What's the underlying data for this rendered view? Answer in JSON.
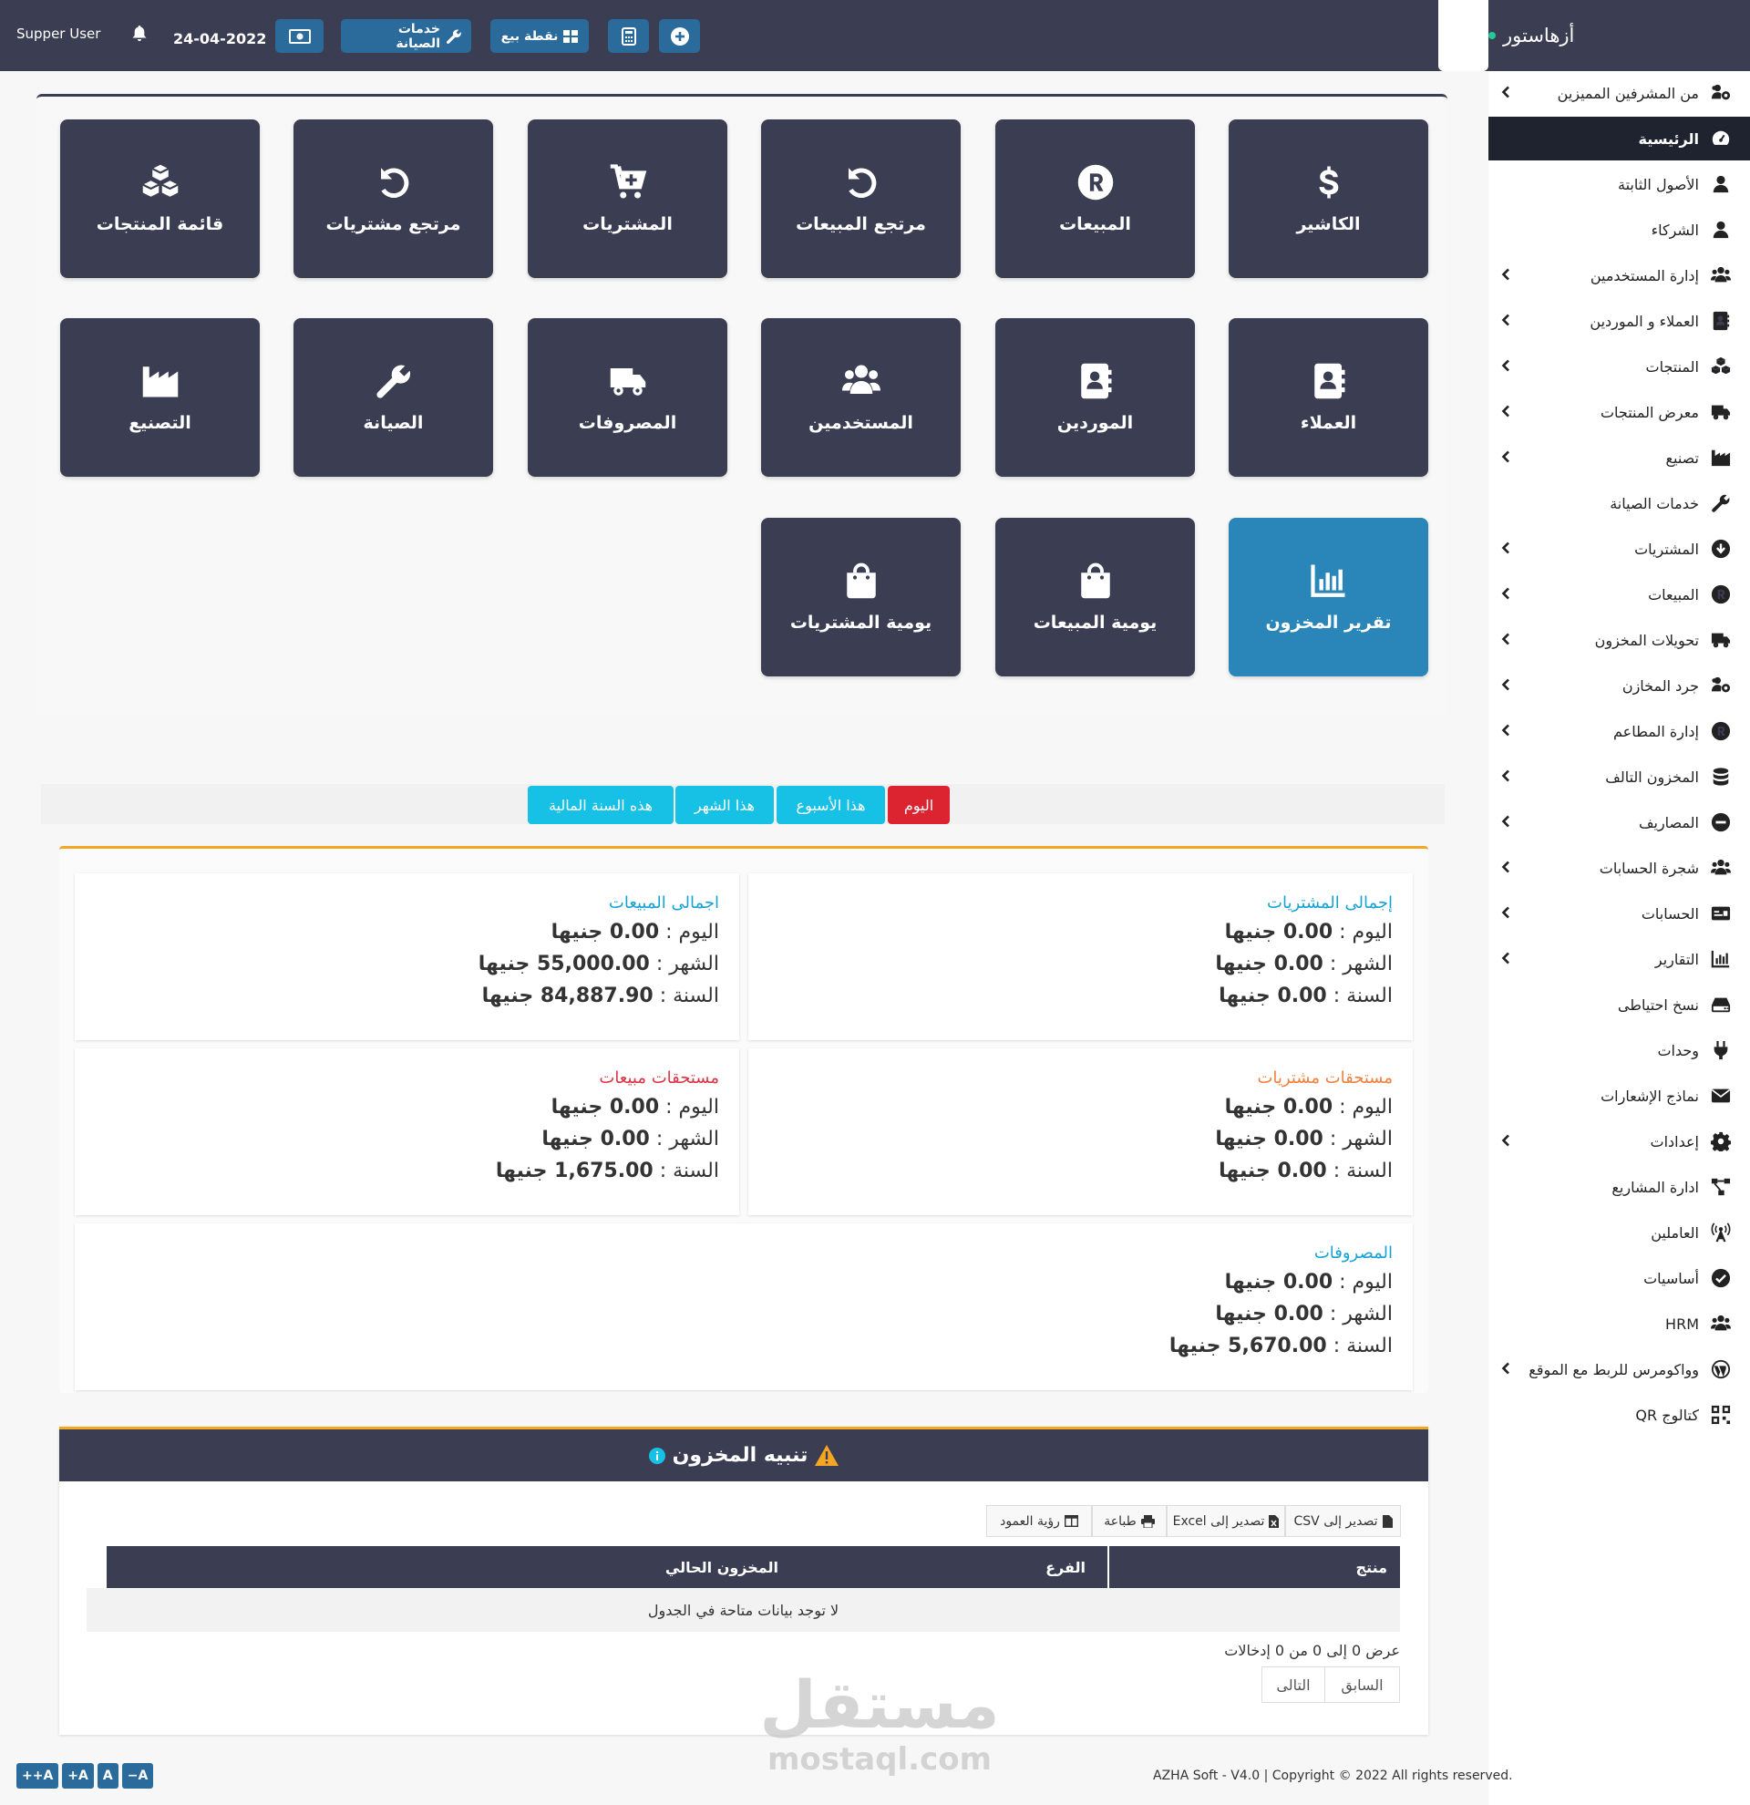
{
  "brand": {
    "name": "أزهاستور"
  },
  "topbar": {
    "user": "Supper User",
    "date": "24-04-2022",
    "maintenance_label": "خدمات الصيانة",
    "pos_label": "نقطة بيع"
  },
  "sidebar": {
    "items": [
      {
        "label": "من المشرفين المميزين",
        "icon": "users-cog-icon",
        "chevron": true
      },
      {
        "label": "الرئيسية",
        "icon": "dashboard-icon",
        "chevron": false,
        "active": true
      },
      {
        "label": "الأصول الثابتة",
        "icon": "user-icon",
        "chevron": false
      },
      {
        "label": "الشركاء",
        "icon": "user-icon",
        "chevron": false
      },
      {
        "label": "إدارة المستخدمين",
        "icon": "users-icon",
        "chevron": true
      },
      {
        "label": "العملاء و الموردين",
        "icon": "address-book-icon",
        "chevron": true
      },
      {
        "label": "المنتجات",
        "icon": "cubes-icon",
        "chevron": true
      },
      {
        "label": "معرض المنتجات",
        "icon": "truck-icon",
        "chevron": true
      },
      {
        "label": "تصنيع",
        "icon": "industry-icon",
        "chevron": true
      },
      {
        "label": "خدمات الصيانة",
        "icon": "wrench-icon",
        "chevron": false
      },
      {
        "label": "المشتريات",
        "icon": "arrow-circle-down-icon",
        "chevron": true
      },
      {
        "label": "المبيعات",
        "icon": "registered-icon",
        "chevron": true
      },
      {
        "label": "تحويلات المخزون",
        "icon": "truck-icon",
        "chevron": true
      },
      {
        "label": "جرد المخازن",
        "icon": "users-cog-icon",
        "chevron": true
      },
      {
        "label": "إدارة المطاعم",
        "icon": "registered-icon",
        "chevron": true
      },
      {
        "label": "المخزون التالف",
        "icon": "database-icon",
        "chevron": true
      },
      {
        "label": "المصاريف",
        "icon": "minus-circle-icon",
        "chevron": true
      },
      {
        "label": "شجرة الحسابات",
        "icon": "users-icon",
        "chevron": true
      },
      {
        "label": "الحسابات",
        "icon": "money-check-icon",
        "chevron": true
      },
      {
        "label": "التقارير",
        "icon": "chart-bar-icon",
        "chevron": true
      },
      {
        "label": "نسخ احتياطى",
        "icon": "hdd-icon",
        "chevron": false
      },
      {
        "label": "وحدات",
        "icon": "plug-icon",
        "chevron": false
      },
      {
        "label": "نماذج الإشعارات",
        "icon": "envelope-icon",
        "chevron": false
      },
      {
        "label": "إعدادات",
        "icon": "gear-icon",
        "chevron": true
      },
      {
        "label": "ادارة المشاريع",
        "icon": "project-diagram-icon",
        "chevron": false
      },
      {
        "label": "العاملين",
        "icon": "broadcast-tower-icon",
        "chevron": false
      },
      {
        "label": "أساسيات",
        "icon": "check-circle-icon",
        "chevron": false
      },
      {
        "label": "HRM",
        "icon": "users-icon",
        "chevron": false
      },
      {
        "label": "وواكومرس للربط مع الموقع",
        "icon": "wordpress-icon",
        "chevron": true
      },
      {
        "label": "كتالوج QR",
        "icon": "qrcode-icon",
        "chevron": false
      }
    ]
  },
  "tiles": [
    {
      "label": "الكاشير",
      "icon": "dollar-icon"
    },
    {
      "label": "المبيعات",
      "icon": "registered-icon"
    },
    {
      "label": "مرتجع المبيعات",
      "icon": "undo-icon"
    },
    {
      "label": "المشتريات",
      "icon": "cart-plus-icon"
    },
    {
      "label": "مرتجع مشتريات",
      "icon": "undo-icon"
    },
    {
      "label": "قائمة المنتجات",
      "icon": "cubes-icon"
    },
    {
      "label": "العملاء",
      "icon": "address-book-icon"
    },
    {
      "label": "الموردين",
      "icon": "address-book-icon"
    },
    {
      "label": "المستخدمين",
      "icon": "users-icon"
    },
    {
      "label": "المصروفات",
      "icon": "truck-icon"
    },
    {
      "label": "الصيانة",
      "icon": "wrench-icon"
    },
    {
      "label": "التصنيع",
      "icon": "industry-icon"
    },
    {
      "label": "تقرير المخزون",
      "icon": "chart-bar-icon",
      "highlight": true
    },
    {
      "label": "يومية المبيعات",
      "icon": "shopping-bag-icon"
    },
    {
      "label": "يومية المشتريات",
      "icon": "shopping-bag-icon"
    }
  ],
  "periods": [
    {
      "label": "اليوم",
      "color": "#dc2430"
    },
    {
      "label": "هذا الأسبوع",
      "color": "#17c0e5"
    },
    {
      "label": "هذا الشهر",
      "color": "#17c0e5"
    },
    {
      "label": "هذه السنة المالية",
      "color": "#17c0e5"
    }
  ],
  "stats": {
    "purchases_total": {
      "title": "إجمالى المشتريات",
      "color": "#17a2d5",
      "today": "اليوم : ",
      "today_val": "0.00 جنيها",
      "month": "الشهر :",
      "month_val": "0.00 جنيها",
      "year": "السنة :",
      "year_val": "0.00 جنيها"
    },
    "sales_total": {
      "title": "اجمالى المبيعات",
      "color": "#17a2d5",
      "today": "اليوم :",
      "today_val": "0.00 جنيها",
      "month": "الشهر :",
      "month_val": "55,000.00 جنيها",
      "year": "السنة :",
      "year_val": "84,887.90 جنيها"
    },
    "purchases_due": {
      "title": "مستحقات مشتريات",
      "color": "#f0803c",
      "today": "اليوم : ",
      "today_val": "0.00 جنيها",
      "month": "الشهر :",
      "month_val": "0.00 جنيها",
      "year": "السنة :",
      "year_val": "0.00 جنيها"
    },
    "sales_due": {
      "title": "مستحقات مبيعات",
      "color": "#dc3545",
      "today": "اليوم :",
      "today_val": "0.00 جنيها",
      "month": "الشهر :",
      "month_val": "0.00 جنيها",
      "year": "السنة :",
      "year_val": "1,675.00 جنيها"
    },
    "expenses": {
      "title": "المصروفات",
      "color": "#17a2d5",
      "today": "اليوم :",
      "today_val": "0.00 جنيها",
      "month": "الشهر :",
      "month_val": "0.00 جنيها",
      "year": "السنة :",
      "year_val": "5,670.00 جنيها"
    }
  },
  "stock_alert": {
    "title": "تنبيه المخزون",
    "buttons": {
      "csv": "تصدير إلى CSV",
      "excel": "تصدير إلى Excel",
      "print": "طباعة",
      "columns": "رؤية العمود"
    },
    "columns": {
      "product": "منتج",
      "branch": "الفرع",
      "stock": "المخزون الحالي"
    },
    "empty": "لا توجد بيانات متاحة في الجدول",
    "info": "عرض 0 إلى 0 من 0 إدخالات",
    "prev": "السابق",
    "next": "التالى"
  },
  "footer": {
    "text": "AZHA Soft - V4.0 | Copyright © 2022 All rights reserved."
  },
  "font_tools": [
    "++A",
    "+A",
    "A",
    "−A"
  ],
  "watermark": {
    "ar": "مستقل",
    "en": "mostaql.com"
  }
}
